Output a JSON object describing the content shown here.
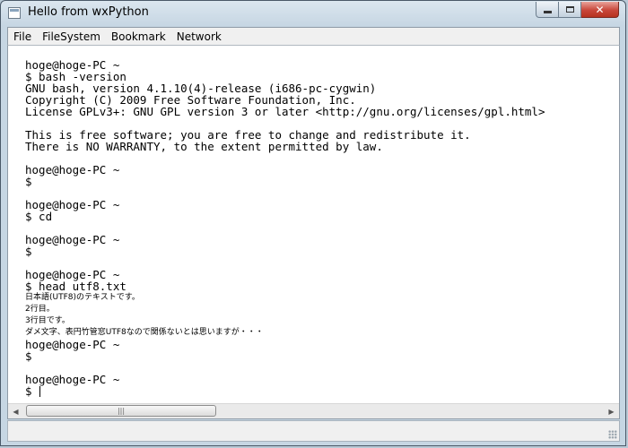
{
  "window": {
    "title": "Hello from wxPython",
    "controls": {
      "minimize_icon": "minimize-icon",
      "maximize_icon": "maximize-icon",
      "close_icon": "close-icon",
      "close_glyph": "✕"
    }
  },
  "menu": [
    "File",
    "FileSystem",
    "Bookmark",
    "Network"
  ],
  "terminal": {
    "lines": [
      "hoge@hoge-PC ~",
      "$ bash -version",
      "GNU bash, version 4.1.10(4)-release (i686-pc-cygwin)",
      "Copyright (C) 2009 Free Software Foundation, Inc.",
      "License GPLv3+: GNU GPL version 3 or later <http://gnu.org/licenses/gpl.html>",
      "",
      "This is free software; you are free to change and redistribute it.",
      "There is NO WARRANTY, to the extent permitted by law.",
      "",
      "hoge@hoge-PC ~",
      "$",
      "",
      "hoge@hoge-PC ~",
      "$ cd",
      "",
      "hoge@hoge-PC ~",
      "$",
      "",
      "hoge@hoge-PC ~",
      "$ head utf8.txt",
      "日本語(UTF8)のテキストです。",
      "2行目。",
      "3行目です。",
      "ダメ文字、表円竹管窓UTF8なので関係ないとは思いますが・・・",
      "hoge@hoge-PC ~",
      "$",
      "",
      "hoge@hoge-PC ~",
      "$ "
    ]
  },
  "scrollbar": {
    "left_arrow": "◀",
    "right_arrow": "▶",
    "grip": "|||"
  },
  "colors": {
    "frame": "#c6d6e3",
    "close_button": "#c8473a",
    "terminal_bg": "#ffffff",
    "text": "#000000"
  }
}
